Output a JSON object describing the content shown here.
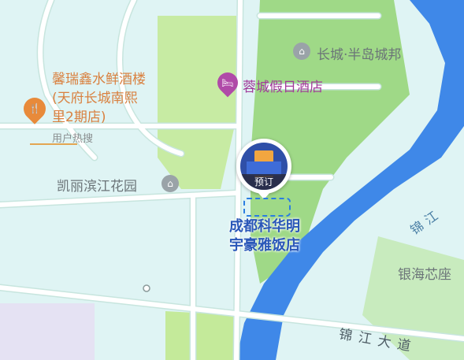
{
  "map": {
    "colors": {
      "land": "#dff4f4",
      "road": "#ffffff",
      "green": "#9fd987",
      "river": "#3f88e8",
      "roadEdge": "#c7e5de"
    },
    "pois": {
      "changcheng": {
        "name": "长城·半岛城邦",
        "icon": "residential-icon"
      },
      "rongcheng": {
        "name": "蓉城假日酒店",
        "icon": "hotel-icon"
      },
      "xinrui": {
        "line1": "馨瑞鑫水鲜酒楼",
        "line2": "(天府长城南熙",
        "line3": "里2期店)",
        "tag": "用户热搜",
        "icon": "restaurant-icon"
      },
      "kaili": {
        "name": "凯丽滨江花园",
        "icon": "residential-icon"
      },
      "yinhai": {
        "name": "银海芯座"
      }
    },
    "river_label": "锦江",
    "road_label": "锦江大道",
    "selected": {
      "name_line1": "成都科华明",
      "name_line2": "宇豪雅饭店",
      "tag": "预订"
    }
  }
}
